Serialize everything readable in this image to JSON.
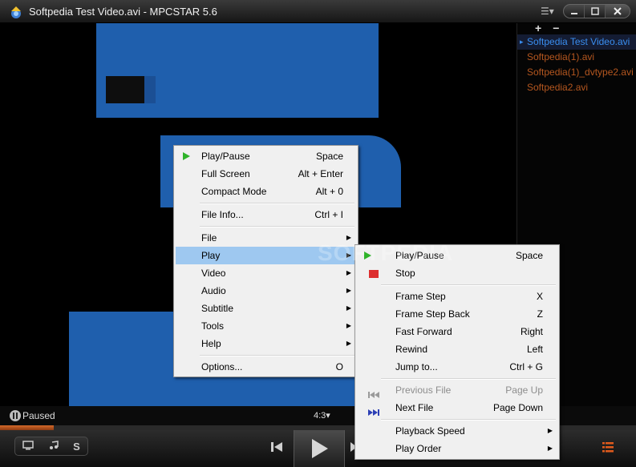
{
  "window": {
    "title": "Softpedia Test Video.avi - MPCSTAR 5.6",
    "list_menu_glyph": "☰▾"
  },
  "playlist": {
    "add_label": "+",
    "remove_label": "−",
    "items": [
      {
        "label": "Softpedia Test Video.avi",
        "active": true
      },
      {
        "label": "Softpedia(1).avi",
        "active": false
      },
      {
        "label": "Softpedia(1)_dvtype2.avi",
        "active": false
      },
      {
        "label": "Softpedia2.avi",
        "active": false
      }
    ]
  },
  "status": {
    "state": "Paused",
    "aspect_ratio": "4:3▾",
    "progress_fraction": 0.085
  },
  "controls": {
    "screen_icon": "monitor-icon",
    "audio_icon": "music-note-icon",
    "subtitle_label": "S"
  },
  "watermark": "SOFTPEDIA",
  "main_menu": [
    {
      "label": "Play/Pause",
      "shortcut": "Space",
      "icon": "play-icon"
    },
    {
      "label": "Full Screen",
      "shortcut": "Alt + Enter"
    },
    {
      "label": "Compact Mode",
      "shortcut": "Alt + 0"
    },
    {
      "separator": true
    },
    {
      "label": "File Info...",
      "shortcut": "Ctrl + I"
    },
    {
      "separator": true
    },
    {
      "label": "File",
      "submenu": true
    },
    {
      "label": "Play",
      "submenu": true,
      "highlighted": true
    },
    {
      "label": "Video",
      "submenu": true
    },
    {
      "label": "Audio",
      "submenu": true
    },
    {
      "label": "Subtitle",
      "submenu": true
    },
    {
      "label": "Tools",
      "submenu": true
    },
    {
      "label": "Help",
      "submenu": true
    },
    {
      "separator": true
    },
    {
      "label": "Options...",
      "shortcut": "O"
    }
  ],
  "play_submenu": [
    {
      "label": "Play/Pause",
      "shortcut": "Space",
      "icon": "play-icon"
    },
    {
      "label": "Stop",
      "shortcut": "",
      "icon": "stop-icon"
    },
    {
      "separator": true
    },
    {
      "label": "Frame Step",
      "shortcut": "X"
    },
    {
      "label": "Frame Step Back",
      "shortcut": "Z"
    },
    {
      "label": "Fast Forward",
      "shortcut": "Right"
    },
    {
      "label": "Rewind",
      "shortcut": "Left"
    },
    {
      "label": "Jump to...",
      "shortcut": "Ctrl + G"
    },
    {
      "separator": true
    },
    {
      "label": "Previous File",
      "shortcut": "Page Up",
      "icon": "previous-file-icon",
      "disabled": true
    },
    {
      "label": "Next File",
      "shortcut": "Page Down",
      "icon": "next-file-icon"
    },
    {
      "separator": true
    },
    {
      "label": "Playback Speed",
      "submenu": true
    },
    {
      "label": "Play Order",
      "submenu": true
    }
  ],
  "colors": {
    "accent_blue": "#3a8ef0",
    "playlist_text": "#b5571f",
    "seek_orange": "#d46a2a",
    "menu_highlight": "#9ec8f0",
    "play_green": "#2fb32a",
    "stop_red": "#dd2e2e"
  }
}
